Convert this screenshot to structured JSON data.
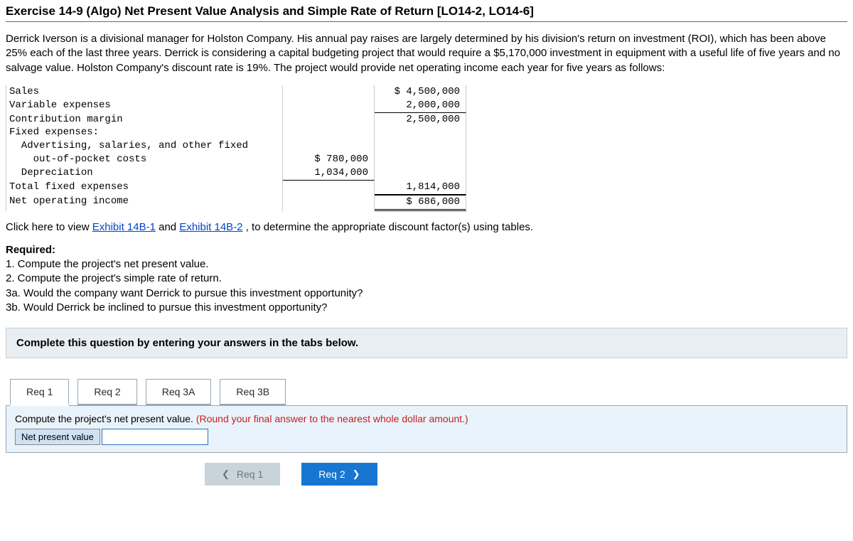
{
  "title": "Exercise 14-9 (Algo) Net Present Value Analysis and Simple Rate of Return [LO14-2, LO14-6]",
  "intro": "Derrick Iverson is a divisional manager for Holston Company. His annual pay raises are largely determined by his division's return on investment (ROI), which has been above 25% each of the last three years. Derrick is considering a capital budgeting project that would require a $5,170,000 investment in equipment with a useful life of five years and no salvage value. Holston Company's discount rate is 19%. The project would provide net operating income each year for five years as follows:",
  "fin": {
    "sales_label": "Sales",
    "sales_val": "$ 4,500,000",
    "varex_label": "Variable expenses",
    "varex_val": "2,000,000",
    "cm_label": "Contribution margin",
    "cm_val": "2,500,000",
    "fixed_hdr": "Fixed expenses:",
    "adv_label": "  Advertising, salaries, and other fixed",
    "oop_label": "    out-of-pocket costs",
    "oop_val": "$ 780,000",
    "dep_label": "  Depreciation",
    "dep_val": "1,034,000",
    "tfe_label": "Total fixed expenses",
    "tfe_val": "1,814,000",
    "noi_label": "Net operating income",
    "noi_val": "$ 686,000"
  },
  "links": {
    "pre": "Click here to view ",
    "l1": "Exhibit 14B-1",
    "mid": " and ",
    "l2": "Exhibit 14B-2",
    "post": ", to determine the appropriate discount factor(s) using tables."
  },
  "required": {
    "hdr": "Required:",
    "r1": "1. Compute the project's net present value.",
    "r2": "2. Compute the project's simple rate of return.",
    "r3a": "3a. Would the company want Derrick to pursue this investment opportunity?",
    "r3b": "3b. Would Derrick be inclined to pursue this investment opportunity?"
  },
  "tabs_hint": "Complete this question by entering your answers in the tabs below.",
  "tabs": {
    "t1": "Req 1",
    "t2": "Req 2",
    "t3a": "Req 3A",
    "t3b": "Req 3B"
  },
  "panel": {
    "prompt_black": "Compute the project's net present value. ",
    "prompt_red": "(Round your final answer to the nearest whole dollar amount.)",
    "row_label": "Net present value"
  },
  "pager": {
    "prev": "Req 1",
    "next": "Req 2"
  }
}
